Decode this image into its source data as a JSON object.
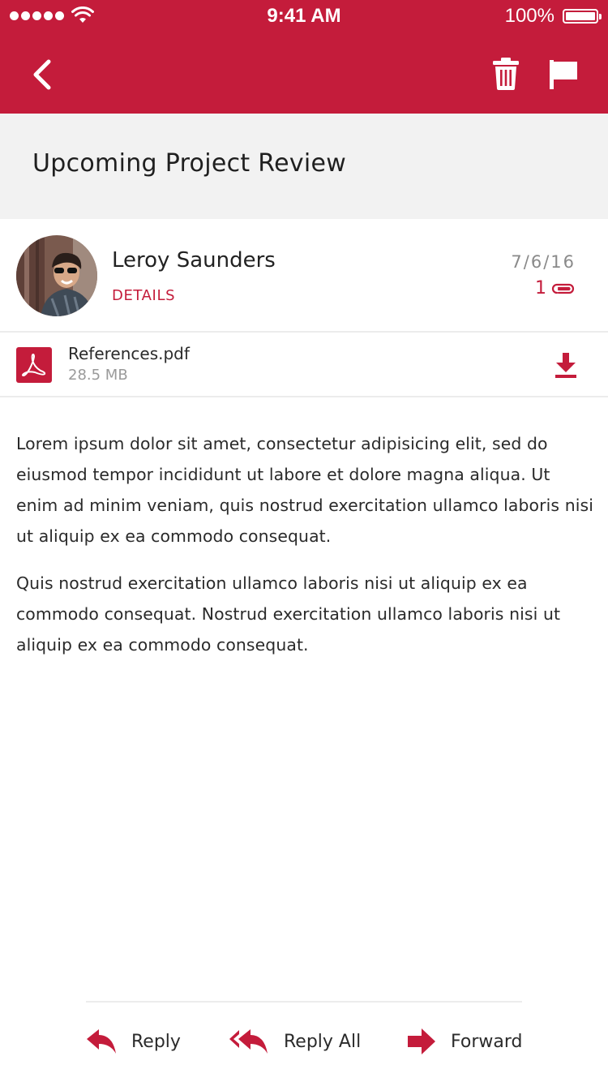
{
  "status_bar": {
    "time": "9:41 AM",
    "battery": "100%"
  },
  "nav": {
    "back_icon": "chevron-left-icon",
    "delete_icon": "trash-icon",
    "flag_icon": "flag-icon"
  },
  "colors": {
    "accent": "#c41c3b",
    "subject_bg": "#f2f2f2",
    "text": "#2b2b2b",
    "muted": "#8a8a8a"
  },
  "email": {
    "subject": "Upcoming Project Review",
    "sender": "Leroy Saunders",
    "details_link": "DETAILS",
    "date": "7/6/16",
    "attachment_count": "1"
  },
  "attachment": {
    "file_name": "References.pdf",
    "file_size": "28.5 MB",
    "type_icon": "pdf-icon",
    "download_icon": "download-icon"
  },
  "body": {
    "paragraphs": [
      "Lorem ipsum dolor sit amet, consectetur adipisicing elit, sed do eiusmod tempor incididunt ut labore et dolore magna aliqua. Ut enim ad minim veniam, quis nostrud exercitation ullamco laboris nisi ut aliquip ex ea commodo consequat.",
      "Quis nostrud exercitation ullamco laboris nisi ut aliquip ex ea commodo consequat. Nostrud exercitation ullamco laboris nisi ut aliquip ex ea commodo consequat."
    ]
  },
  "actions": {
    "reply": "Reply",
    "reply_all": "Reply All",
    "forward": "Forward"
  }
}
